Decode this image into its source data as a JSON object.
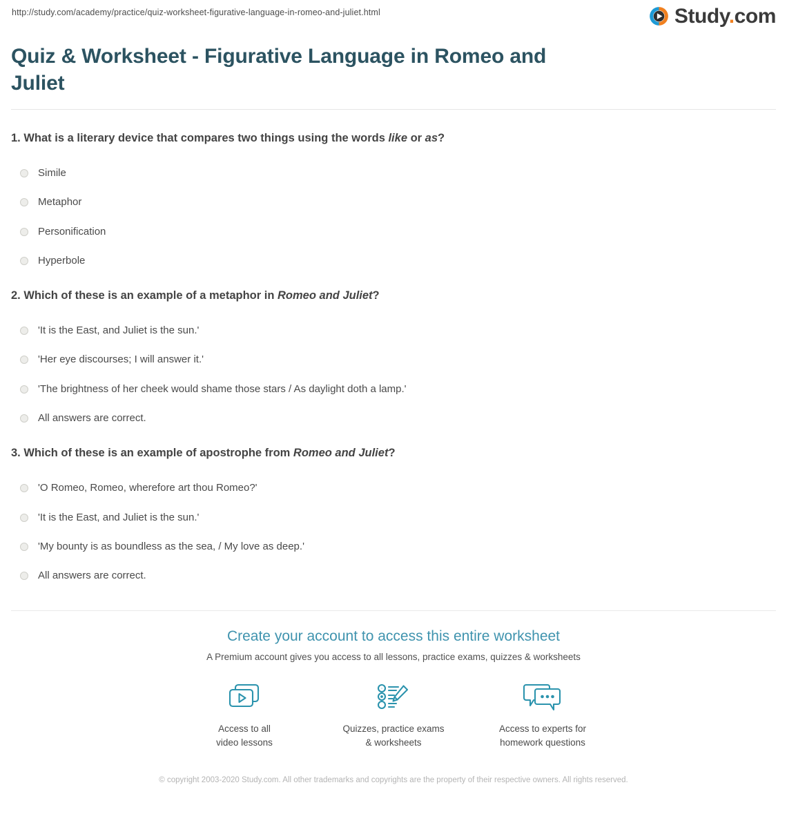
{
  "browser": {
    "url": "http://study.com/academy/practice/quiz-worksheet-figurative-language-in-romeo-and-juliet.html"
  },
  "brand": {
    "name": "Study",
    "dot": ".",
    "tld": "com",
    "accent_orange": "#f08020",
    "accent_blue": "#1d9ad6",
    "logo_text_color": "#3b3b3b"
  },
  "header": {
    "title": "Quiz & Worksheet - Figurative Language in Romeo and Juliet",
    "title_color": "#2c5361"
  },
  "quiz": {
    "questions": [
      {
        "number": "1.",
        "text_parts": [
          {
            "text": "1. What is a literary device that compares two things using the words ",
            "italic": false
          },
          {
            "text": "like",
            "italic": true
          },
          {
            "text": " or ",
            "italic": false
          },
          {
            "text": "as",
            "italic": true
          },
          {
            "text": "?",
            "italic": false
          }
        ],
        "options": [
          "Simile",
          "Metaphor",
          "Personification",
          "Hyperbole"
        ]
      },
      {
        "number": "2.",
        "text_parts": [
          {
            "text": "2. Which of these is an example of a metaphor in ",
            "italic": false
          },
          {
            "text": "Romeo and Juliet",
            "italic": true
          },
          {
            "text": "?",
            "italic": false
          }
        ],
        "options": [
          "'It is the East, and Juliet is the sun.'",
          "'Her eye discourses; I will answer it.'",
          "'The brightness of her cheek would shame those stars / As daylight doth a lamp.'",
          "All answers are correct."
        ]
      },
      {
        "number": "3.",
        "text_parts": [
          {
            "text": "3. Which of these is an example of apostrophe from ",
            "italic": false
          },
          {
            "text": "Romeo and Juliet",
            "italic": true
          },
          {
            "text": "?",
            "italic": false
          }
        ],
        "options": [
          "'O Romeo, Romeo, wherefore art thou Romeo?'",
          "'It is the East, and Juliet is the sun.'",
          "'My bounty is as boundless as the sea, / My love as deep.'",
          "All answers are correct."
        ]
      }
    ]
  },
  "cta": {
    "title": "Create your account to access this entire worksheet",
    "subtitle": "A Premium account gives you access to all lessons, practice exams, quizzes & worksheets",
    "title_color": "#3f93ae",
    "icon_color": "#2b93ad",
    "features": [
      {
        "icon": "video-lessons-icon",
        "label": "Access to all\nvideo lessons"
      },
      {
        "icon": "quiz-pencil-icon",
        "label": "Quizzes, practice exams\n& worksheets"
      },
      {
        "icon": "chat-bubbles-icon",
        "label": "Access to experts for\nhomework questions"
      }
    ]
  },
  "footer": {
    "copyright": "© copyright 2003-2020 Study.com. All other trademarks and copyrights are the property of their respective owners. All rights reserved."
  }
}
